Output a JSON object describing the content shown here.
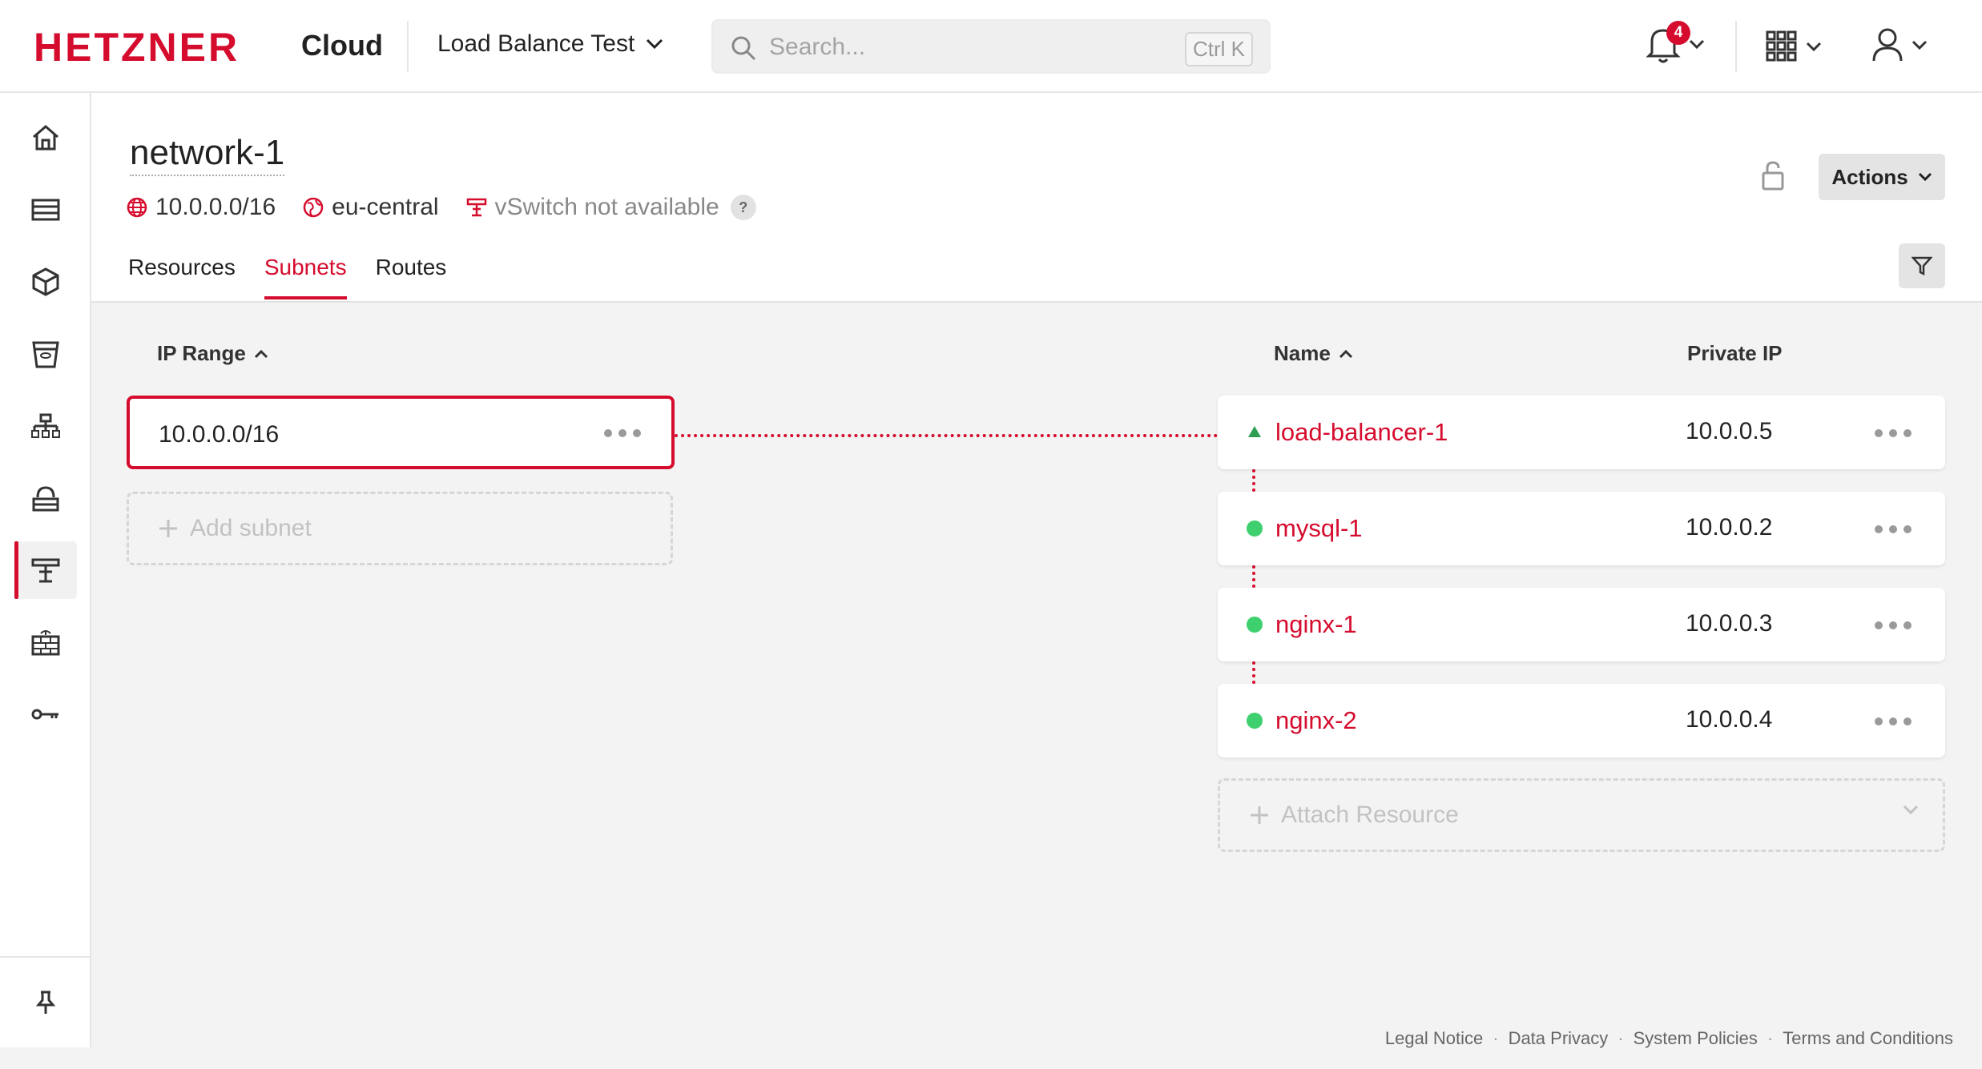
{
  "header": {
    "logo_text": "HETZNER",
    "product": "Cloud",
    "project": "Load Balance Test",
    "search_placeholder": "Search...",
    "search_shortcut": "Ctrl K",
    "notification_count": "4"
  },
  "sidebar": {
    "items": [
      {
        "icon": "home-icon"
      },
      {
        "icon": "servers-icon"
      },
      {
        "icon": "volumes-icon"
      },
      {
        "icon": "storage-box-icon"
      },
      {
        "icon": "load-balancers-icon"
      },
      {
        "icon": "floating-ips-icon"
      },
      {
        "icon": "networks-icon",
        "active": true
      },
      {
        "icon": "firewalls-icon"
      },
      {
        "icon": "ssh-keys-icon"
      }
    ],
    "pin_icon": "pin-icon"
  },
  "page": {
    "title": "network-1",
    "ip_range": "10.0.0.0/16",
    "zone": "eu-central",
    "vswitch": "vSwitch not available",
    "help": "?",
    "actions_label": "Actions"
  },
  "tabs": [
    {
      "label": "Resources",
      "active": false
    },
    {
      "label": "Subnets",
      "active": true
    },
    {
      "label": "Routes",
      "active": false
    }
  ],
  "columns": {
    "ip_range": "IP Range",
    "name": "Name",
    "private_ip": "Private IP"
  },
  "subnet": {
    "range": "10.0.0.0/16",
    "add_label": "Add subnet"
  },
  "resources": [
    {
      "name": "load-balancer-1",
      "ip": "10.0.0.5",
      "kind": "load-balancer",
      "status_color": "#2e9e52"
    },
    {
      "name": "mysql-1",
      "ip": "10.0.0.2",
      "kind": "server",
      "status_color": "#3ecf6e"
    },
    {
      "name": "nginx-1",
      "ip": "10.0.0.3",
      "kind": "server",
      "status_color": "#3ecf6e"
    },
    {
      "name": "nginx-2",
      "ip": "10.0.0.4",
      "kind": "server",
      "status_color": "#3ecf6e"
    }
  ],
  "attach_label": "Attach Resource",
  "footer": {
    "links": [
      "Legal Notice",
      "Data Privacy",
      "System Policies",
      "Terms and Conditions"
    ]
  },
  "colors": {
    "accent": "#d50c2d",
    "online": "#3ecf6e"
  }
}
